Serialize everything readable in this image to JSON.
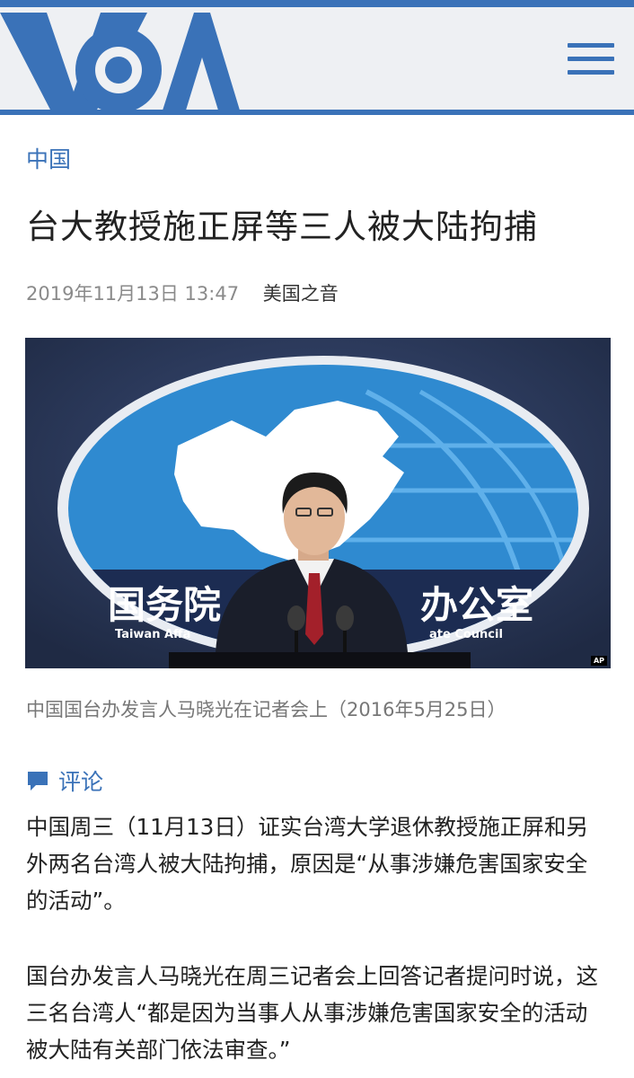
{
  "header": {
    "logo_text": "VOA",
    "brand_color": "#3a72b8",
    "menu_icon": "hamburger-menu-icon"
  },
  "article": {
    "category": "中国",
    "title": "台大教授施正屏等三人被大陆拘捕",
    "date": "2019年11月13日 13:47",
    "source": "美国之音",
    "image": {
      "sign_main_left": "国务院",
      "sign_main_right": "办公室",
      "sign_sub_left": "Taiwan Affa",
      "sign_sub_right": "ate Council",
      "credit": "AP"
    },
    "caption": "中国国台办发言人马晓光在记者会上（2016年5月25日）",
    "comment_label": "评论",
    "paragraphs": [
      "中国周三（11月13日）证实台湾大学退休教授施正屏和另外两名台湾人被大陆拘捕，原因是“从事涉嫌危害国家安全的活动”。",
      "国台办发言人马晓光在周三记者会上回答记者提问时说，这三名台湾人“都是因为当事人从事涉嫌危害国家安全的活动被大陆有关部门依法审查。”"
    ]
  }
}
